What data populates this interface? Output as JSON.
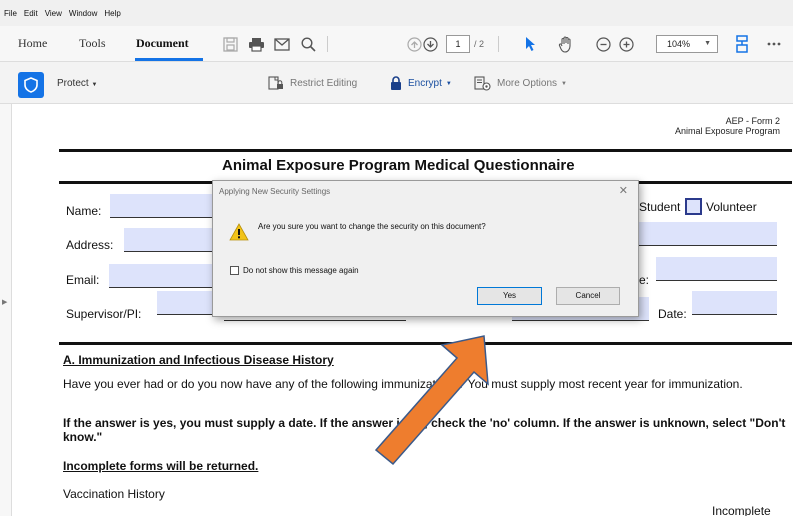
{
  "menu": [
    "File",
    "Edit",
    "View",
    "Window",
    "Help"
  ],
  "tabs": {
    "home": "Home",
    "tools": "Tools",
    "document": "Document"
  },
  "toolbar": {
    "page_current": "1",
    "page_total": "/ 2",
    "zoom": "104%"
  },
  "protect": {
    "label": "Protect",
    "restrict": "Restrict Editing",
    "encrypt": "Encrypt",
    "more": "More Options"
  },
  "document": {
    "form_id": "AEP - Form 2",
    "program": "Animal Exposure Program",
    "title": "Animal Exposure Program Medical Questionnaire",
    "labels": {
      "name": "Name:",
      "address": "Address:",
      "email": "Email:",
      "supervisor": "Supervisor/PI:",
      "student": "Student",
      "volunteer": "Volunteer",
      "phone": "e:",
      "date": "Date:"
    },
    "section_a": "A. Immunization and Infectious Disease History",
    "para1": "Have you ever had or do you now have any of the following immunizations? You must supply most recent year for immunization.",
    "para2": "If the answer is yes, you must supply a date. If the answer is no, check the 'no' column. If the answer is unknown, select \"Don't know.\"",
    "para3": "Incomplete forms will be returned.",
    "vaccination": "Vaccination History",
    "incomplete": "Incomplete"
  },
  "dialog": {
    "title": "Applying New Security Settings",
    "message": "Are you sure you want to change the security on this document?",
    "checkbox": "Do not show this message again",
    "yes": "Yes",
    "cancel": "Cancel"
  },
  "colors": {
    "accent": "#1473e6",
    "field_fill": "#dde3fb",
    "arrow": "#ee7d2e"
  }
}
